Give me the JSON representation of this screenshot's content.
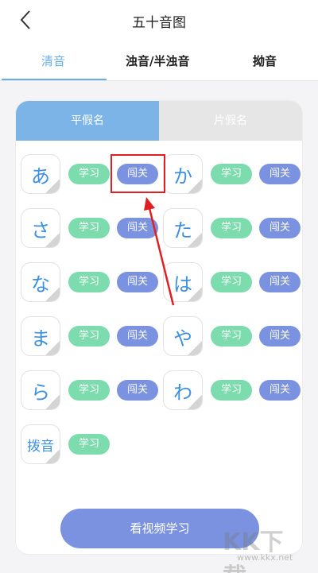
{
  "header": {
    "title": "五十音图",
    "back_icon": "chevron-left-icon"
  },
  "tabs": [
    {
      "label": "清音",
      "active": true
    },
    {
      "label": "浊音/半浊音",
      "active": false
    },
    {
      "label": "拗音",
      "active": false
    }
  ],
  "segments": [
    {
      "label": "平假名",
      "active": true
    },
    {
      "label": "片假名",
      "active": false
    }
  ],
  "learn_label": "学习",
  "pass_label": "闯关",
  "kana_rows": [
    [
      {
        "kana": "あ",
        "has_pass": true
      },
      {
        "kana": "か",
        "has_pass": true
      }
    ],
    [
      {
        "kana": "さ",
        "has_pass": true
      },
      {
        "kana": "た",
        "has_pass": true
      }
    ],
    [
      {
        "kana": "な",
        "has_pass": true
      },
      {
        "kana": "は",
        "has_pass": true
      }
    ],
    [
      {
        "kana": "ま",
        "has_pass": true
      },
      {
        "kana": "や",
        "has_pass": true
      }
    ],
    [
      {
        "kana": "ら",
        "has_pass": true
      },
      {
        "kana": "わ",
        "has_pass": true
      }
    ],
    [
      {
        "kana": "拨音",
        "has_pass": false
      }
    ]
  ],
  "video_button": "看视频学习",
  "watermark": {
    "text": "KK下载",
    "url": "www.kkx.net"
  },
  "colors": {
    "accent": "#6aaee6",
    "learn": "#7cdcae",
    "pass": "#7b92e0",
    "kana": "#3d8fe0",
    "annotation": "#e02020"
  }
}
